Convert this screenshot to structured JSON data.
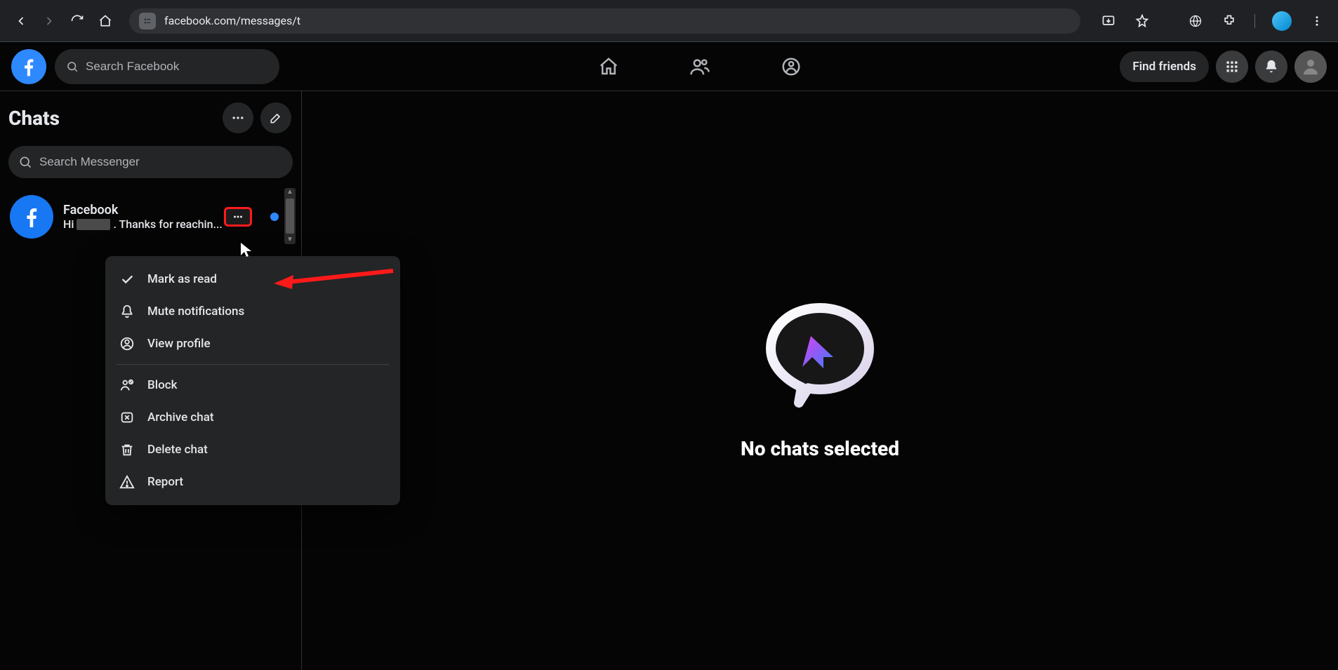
{
  "browser": {
    "url": "facebook.com/messages/t"
  },
  "fb_header": {
    "search_placeholder": "Search Facebook",
    "find_friends_label": "Find friends"
  },
  "sidebar": {
    "title": "Chats",
    "search_placeholder": "Search Messenger",
    "chat": {
      "name": "Facebook",
      "snippet_prefix": "Hi ",
      "snippet_suffix": ". Thanks for reachin..."
    }
  },
  "context_menu": {
    "mark_as_read": "Mark as read",
    "mute_notifications": "Mute notifications",
    "view_profile": "View profile",
    "block": "Block",
    "archive_chat": "Archive chat",
    "delete_chat": "Delete chat",
    "report": "Report"
  },
  "main": {
    "empty_title": "No chats selected"
  }
}
